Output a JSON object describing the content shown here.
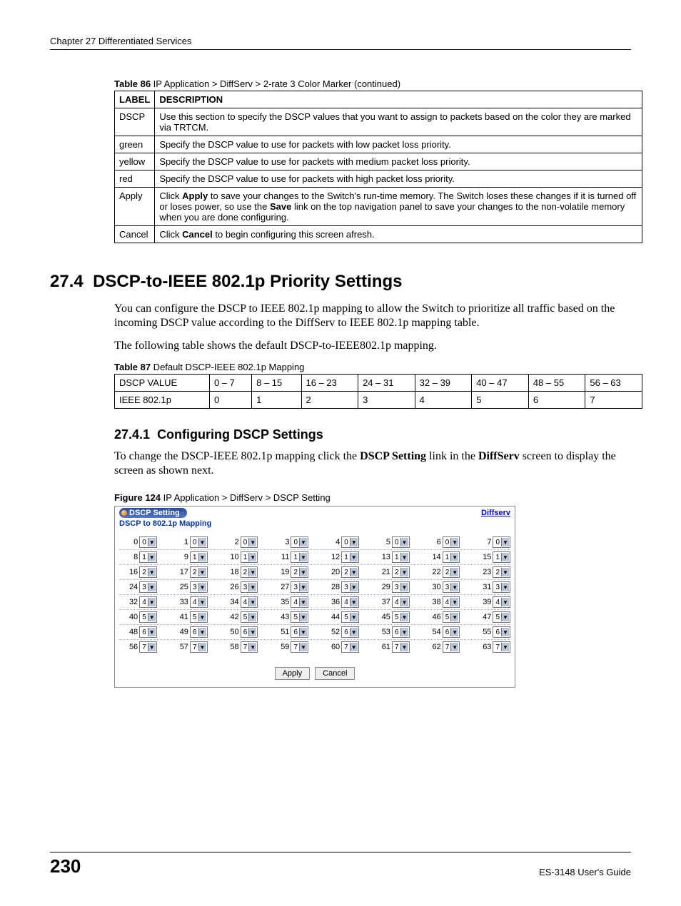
{
  "header": "Chapter 27 Differentiated Services",
  "table86": {
    "caption_bold": "Table 86",
    "caption_rest": "   IP Application > DiffServ > 2-rate 3 Color Marker  (continued)",
    "headers": [
      "LABEL",
      "DESCRIPTION"
    ],
    "rows": [
      {
        "label": "DSCP",
        "desc": "Use this section to specify the DSCP values that you want to assign to packets based on the color they are marked via TRTCM."
      },
      {
        "label": "green",
        "desc": "Specify the DSCP value to use for packets with low packet loss priority."
      },
      {
        "label": "yellow",
        "desc": "Specify the DSCP value to use for packets with medium packet loss priority."
      },
      {
        "label": "red",
        "desc": "Specify the DSCP value to use for packets with high packet loss priority."
      },
      {
        "label": "Apply",
        "desc_pre": "Click ",
        "desc_b1": "Apply",
        "desc_mid": " to save your changes to the Switch's run-time memory. The Switch loses these changes if it is turned off or loses power, so use the ",
        "desc_b2": "Save",
        "desc_post": " link on the top navigation panel to save your changes to the non-volatile memory when you are done configuring."
      },
      {
        "label": "Cancel",
        "desc_pre": "Click ",
        "desc_b1": "Cancel",
        "desc_post": " to begin configuring this screen afresh."
      }
    ]
  },
  "section": {
    "number": "27.4",
    "title": "DSCP-to-IEEE 802.1p Priority Settings",
    "para1": "You can configure the DSCP to IEEE 802.1p mapping to allow the Switch to prioritize all traffic based on the incoming DSCP value according to the DiffServ to IEEE 802.1p mapping table.",
    "para2": "The following table shows the default DSCP-to-IEEE802.1p mapping."
  },
  "table87": {
    "caption_bold": "Table 87",
    "caption_rest": "   Default DSCP-IEEE 802.1p Mapping",
    "row1": [
      "DSCP VALUE",
      "0 – 7",
      "8 – 15",
      "16 – 23",
      "24 – 31",
      "32 – 39",
      "40 – 47",
      "48 – 55",
      "56 – 63"
    ],
    "row2": [
      "IEEE 802.1p",
      "0",
      "1",
      "2",
      "3",
      "4",
      "5",
      "6",
      "7"
    ]
  },
  "subsection": {
    "number": "27.4.1",
    "title": "Configuring DSCP Settings",
    "para_pre": "To change the DSCP-IEEE 802.1p mapping click the ",
    "para_b1": "DSCP Setting",
    "para_mid": " link in the ",
    "para_b2": "DiffServ",
    "para_post": " screen to display the screen as shown next."
  },
  "figure": {
    "caption_bold": "Figure 124",
    "caption_rest": "   IP Application > DiffServ > DSCP Setting",
    "title": "DSCP Setting",
    "link": "Diffserv",
    "subtitle": "DSCP to 802.1p Mapping",
    "apply": "Apply",
    "cancel": "Cancel"
  },
  "chart_data": {
    "type": "table",
    "description": "DSCP to 802.1p mapping grid: cell index 0..63 with selected priority value",
    "columns": 8,
    "rows": 8,
    "cells": [
      {
        "idx": 0,
        "val": 0
      },
      {
        "idx": 1,
        "val": 0
      },
      {
        "idx": 2,
        "val": 0
      },
      {
        "idx": 3,
        "val": 0
      },
      {
        "idx": 4,
        "val": 0
      },
      {
        "idx": 5,
        "val": 0
      },
      {
        "idx": 6,
        "val": 0
      },
      {
        "idx": 7,
        "val": 0
      },
      {
        "idx": 8,
        "val": 1
      },
      {
        "idx": 9,
        "val": 1
      },
      {
        "idx": 10,
        "val": 1
      },
      {
        "idx": 11,
        "val": 1
      },
      {
        "idx": 12,
        "val": 1
      },
      {
        "idx": 13,
        "val": 1
      },
      {
        "idx": 14,
        "val": 1
      },
      {
        "idx": 15,
        "val": 1
      },
      {
        "idx": 16,
        "val": 2
      },
      {
        "idx": 17,
        "val": 2
      },
      {
        "idx": 18,
        "val": 2
      },
      {
        "idx": 19,
        "val": 2
      },
      {
        "idx": 20,
        "val": 2
      },
      {
        "idx": 21,
        "val": 2
      },
      {
        "idx": 22,
        "val": 2
      },
      {
        "idx": 23,
        "val": 2
      },
      {
        "idx": 24,
        "val": 3
      },
      {
        "idx": 25,
        "val": 3
      },
      {
        "idx": 26,
        "val": 3
      },
      {
        "idx": 27,
        "val": 3
      },
      {
        "idx": 28,
        "val": 3
      },
      {
        "idx": 29,
        "val": 3
      },
      {
        "idx": 30,
        "val": 3
      },
      {
        "idx": 31,
        "val": 3
      },
      {
        "idx": 32,
        "val": 4
      },
      {
        "idx": 33,
        "val": 4
      },
      {
        "idx": 34,
        "val": 4
      },
      {
        "idx": 35,
        "val": 4
      },
      {
        "idx": 36,
        "val": 4
      },
      {
        "idx": 37,
        "val": 4
      },
      {
        "idx": 38,
        "val": 4
      },
      {
        "idx": 39,
        "val": 4
      },
      {
        "idx": 40,
        "val": 5
      },
      {
        "idx": 41,
        "val": 5
      },
      {
        "idx": 42,
        "val": 5
      },
      {
        "idx": 43,
        "val": 5
      },
      {
        "idx": 44,
        "val": 5
      },
      {
        "idx": 45,
        "val": 5
      },
      {
        "idx": 46,
        "val": 5
      },
      {
        "idx": 47,
        "val": 5
      },
      {
        "idx": 48,
        "val": 6
      },
      {
        "idx": 49,
        "val": 6
      },
      {
        "idx": 50,
        "val": 6
      },
      {
        "idx": 51,
        "val": 6
      },
      {
        "idx": 52,
        "val": 6
      },
      {
        "idx": 53,
        "val": 6
      },
      {
        "idx": 54,
        "val": 6
      },
      {
        "idx": 55,
        "val": 6
      },
      {
        "idx": 56,
        "val": 7
      },
      {
        "idx": 57,
        "val": 7
      },
      {
        "idx": 58,
        "val": 7
      },
      {
        "idx": 59,
        "val": 7
      },
      {
        "idx": 60,
        "val": 7
      },
      {
        "idx": 61,
        "val": 7
      },
      {
        "idx": 62,
        "val": 7
      },
      {
        "idx": 63,
        "val": 7
      }
    ]
  },
  "footer": {
    "page": "230",
    "guide": "ES-3148 User's Guide"
  }
}
